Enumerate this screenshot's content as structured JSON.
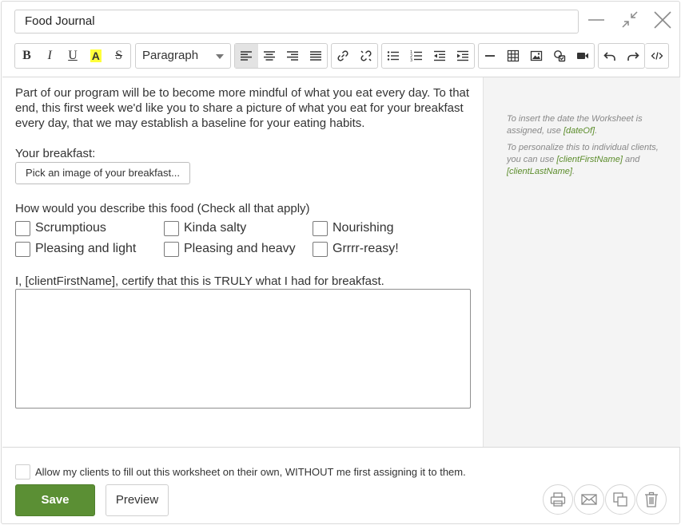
{
  "header": {
    "title_value": "Food Journal",
    "minimize_icon": "minimize-icon",
    "collapse_icon": "collapse-arrows-icon",
    "close_icon": "close-icon"
  },
  "toolbar": {
    "bold": "B",
    "italic": "I",
    "underline": "U",
    "highlight": "A",
    "strikethrough": "S",
    "format_value": "Paragraph",
    "highlight_color": "#ffff3b"
  },
  "editor": {
    "intro": "Part of our program will be to become more mindful of what you eat every day. To that end, this first week we'd like you to share a picture of what you eat for your breakfast every day, that we may establish a baseline for your eating habits.",
    "breakfast_label": "Your breakfast:",
    "pick_image_label": "Pick an image of your breakfast...",
    "describe_label": "How would you describe this food (Check all that apply)",
    "options": [
      "Scrumptious",
      "Kinda salty",
      "Nourishing",
      "Pleasing and light",
      "Pleasing and heavy",
      "Grrrr-reasy!"
    ],
    "certify_label": "I, [clientFirstName], certify that this is TRULY what I had for breakfast."
  },
  "sidebar": {
    "date_hint_prefix": "To insert the date the Worksheet is assigned, use ",
    "date_tag": "[dateOf]",
    "date_hint_suffix": ".",
    "personalize_prefix": "To personalize this to individual clients, you can use ",
    "first_name_tag": "[clientFirstName]",
    "and_word": " and ",
    "last_name_tag": "[clientLastName]",
    "personalize_suffix": "."
  },
  "footer": {
    "allow_label": "Allow my clients to fill out this worksheet on their own, WITHOUT me first assigning it to them.",
    "save_label": "Save",
    "preview_label": "Preview",
    "accent_color": "#5b8f34"
  }
}
